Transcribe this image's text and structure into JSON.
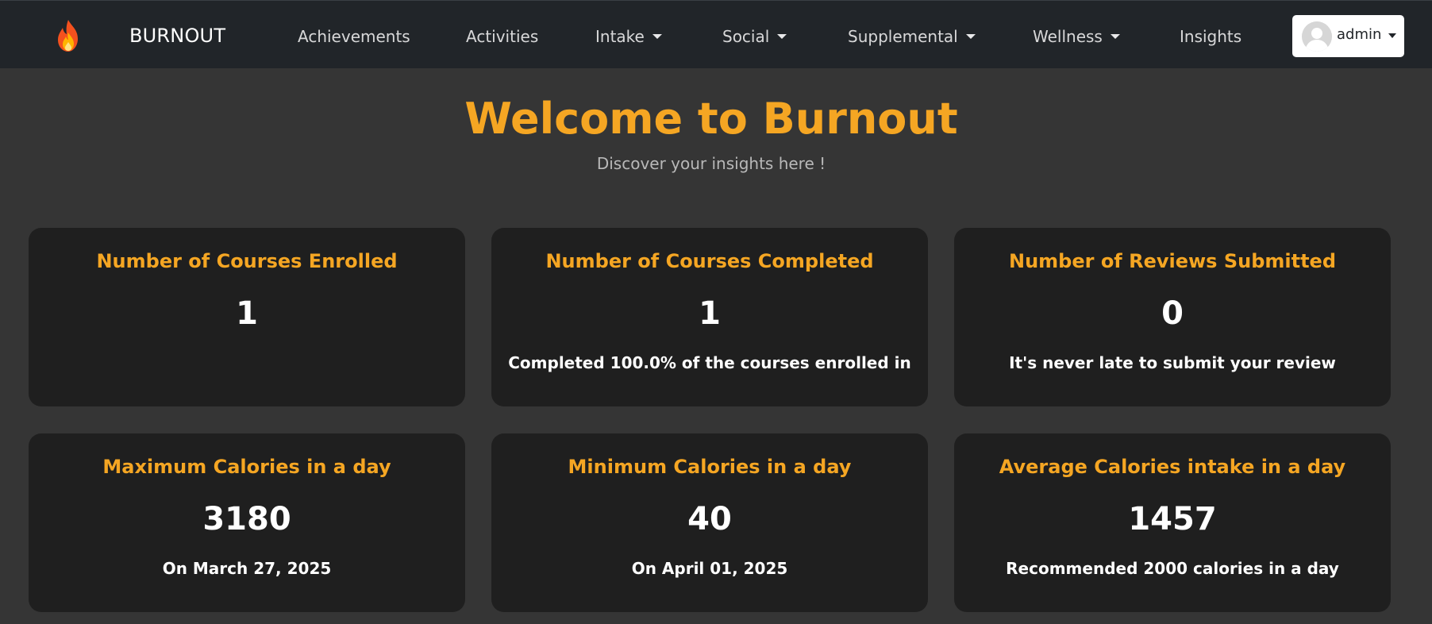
{
  "nav": {
    "brand_icon": "flame-icon",
    "brand": "BURNOUT",
    "items": [
      {
        "label": "Achievements",
        "dropdown": false
      },
      {
        "label": "Activities",
        "dropdown": false
      },
      {
        "label": "Intake",
        "dropdown": true
      },
      {
        "label": "Social",
        "dropdown": true
      },
      {
        "label": "Supplemental",
        "dropdown": true
      },
      {
        "label": "Wellness",
        "dropdown": true
      },
      {
        "label": "Insights",
        "dropdown": false
      }
    ],
    "user": {
      "name": "admin",
      "avatar_icon": "user-avatar-icon"
    }
  },
  "hero": {
    "title": "Welcome to Burnout",
    "subtitle": "Discover your insights here !"
  },
  "cards": [
    {
      "title": "Number of Courses Enrolled",
      "value": "1",
      "note": ""
    },
    {
      "title": "Number of Courses Completed",
      "value": "1",
      "note": "Completed 100.0% of the courses enrolled in"
    },
    {
      "title": "Number of Reviews Submitted",
      "value": "0",
      "note": "It's never late to submit your review"
    },
    {
      "title": "Maximum Calories in a day",
      "value": "3180",
      "note": "On March 27, 2025"
    },
    {
      "title": "Minimum Calories in a day",
      "value": "40",
      "note": "On April 01, 2025"
    },
    {
      "title": "Average Calories intake in a day",
      "value": "1457",
      "note": "Recommended 2000 calories in a day"
    }
  ],
  "colors": {
    "accent": "#f5a623",
    "navbar_bg": "#212529",
    "page_bg": "#353535",
    "card_bg": "#1f1f1f"
  }
}
